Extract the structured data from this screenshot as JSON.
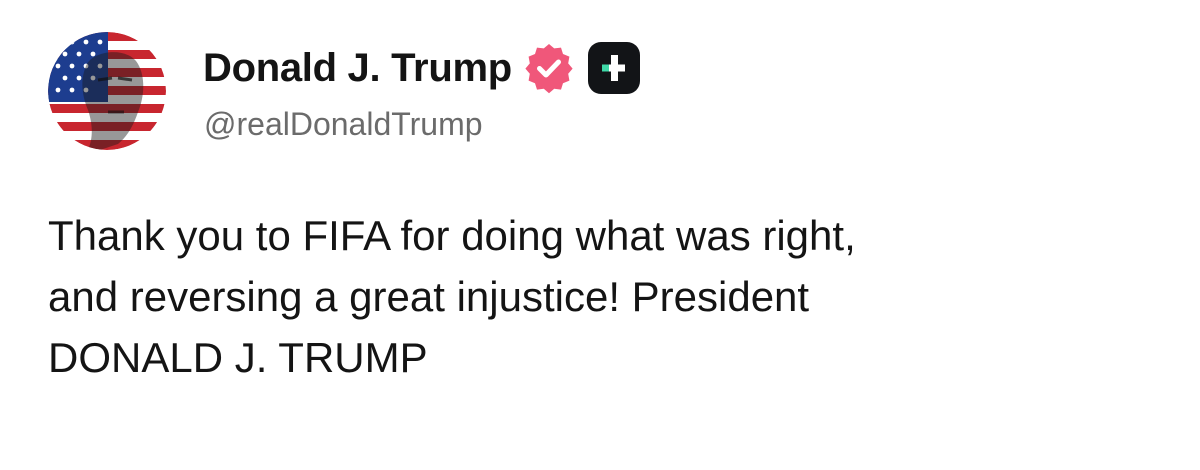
{
  "author": {
    "display_name": "Donald J. Trump",
    "handle": "@realDonaldTrump",
    "avatar_icon": "flag-portrait-avatar",
    "verified": true,
    "verified_icon": "verified-badge-icon",
    "app_icon": "truth-social-app-icon"
  },
  "post": {
    "lines": [
      "Thank you to FIFA for doing what was right,",
      "and reversing a great injustice! President",
      "DONALD J. TRUMP"
    ]
  },
  "colors": {
    "verified_badge": "#f0577a",
    "app_badge_bg": "#121417",
    "app_badge_accent": "#3fd9a8",
    "handle_text": "#6b6b6b",
    "flag_red": "#c8262f",
    "flag_blue": "#1d3d8f"
  }
}
